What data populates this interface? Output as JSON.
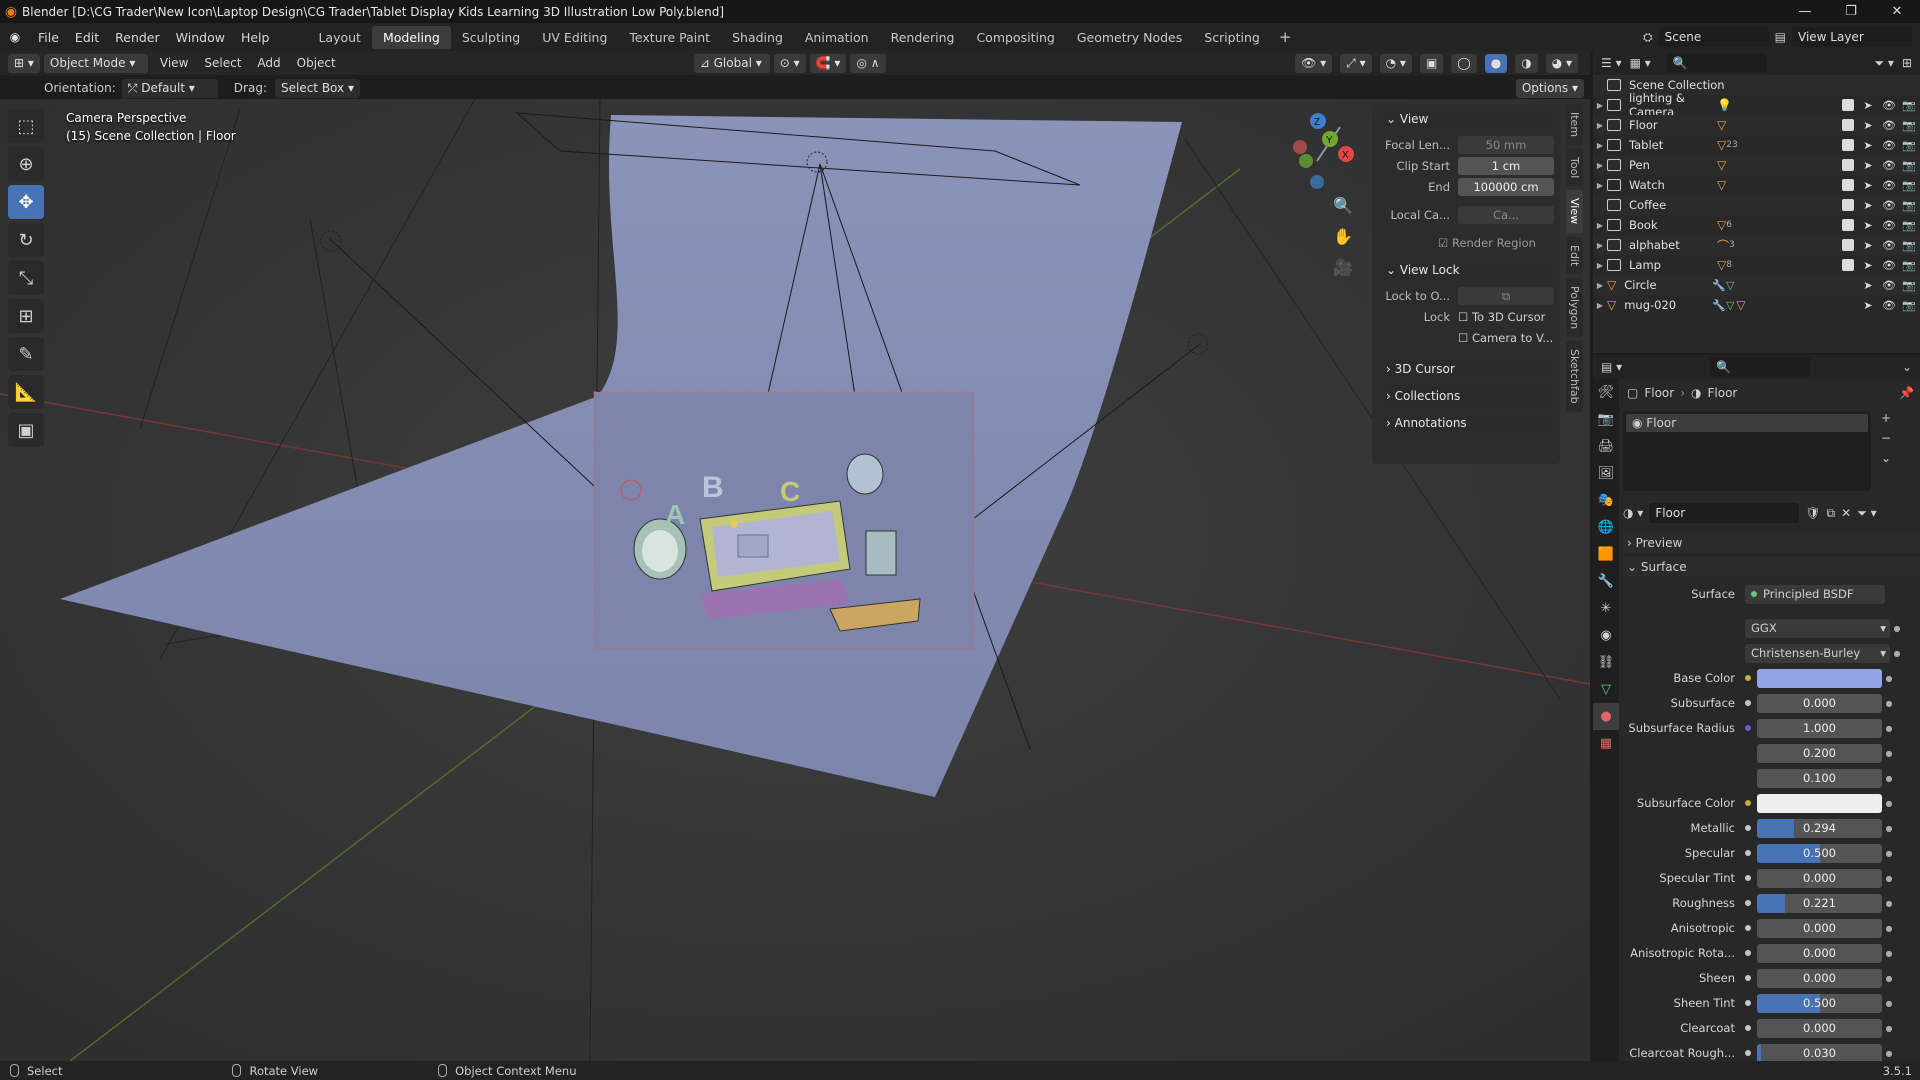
{
  "titlebar": {
    "title": "Blender [D:\\CG Trader\\New Icon\\Laptop Design\\CG Trader\\Tablet Display Kids Learning 3D Illustration Low Poly.blend]",
    "minimize": "—",
    "maximize": "❐",
    "close": "✕"
  },
  "menu": {
    "items": [
      "File",
      "Edit",
      "Render",
      "Window",
      "Help"
    ],
    "workspaces": [
      "Layout",
      "Modeling",
      "Sculpting",
      "UV Editing",
      "Texture Paint",
      "Shading",
      "Animation",
      "Rendering",
      "Compositing",
      "Geometry Nodes",
      "Scripting"
    ],
    "active_workspace": "Modeling",
    "add": "+",
    "scene": "Scene",
    "view_layer": "View Layer"
  },
  "header": {
    "mode": "Object Mode",
    "menus": [
      "View",
      "Select",
      "Add",
      "Object"
    ],
    "transform": "Global",
    "orientation_label": "Orientation:",
    "orientation": "Default",
    "drag_label": "Drag:",
    "drag": "Select Box",
    "options": "Options"
  },
  "viewport": {
    "info_line1": "Camera Perspective",
    "info_line2": "(15) Scene Collection | Floor",
    "gizmo": {
      "x": "X",
      "y": "Y",
      "z": "Z"
    }
  },
  "npanel": {
    "view_header": "View",
    "focal_label": "Focal Len...",
    "focal": "50 mm",
    "clip_start_label": "Clip Start",
    "clip_start": "1 cm",
    "end_label": "End",
    "end": "100000 cm",
    "local_cam_label": "Local Ca...",
    "local_cam": "Ca...",
    "render_region": "Render Region",
    "view_lock": "View Lock",
    "lock_to_label": "Lock to O...",
    "lock_label": "Lock",
    "to_cursor": "To 3D Cursor",
    "cam_to_view": "Camera to V...",
    "cursor3d": "3D Cursor",
    "collections": "Collections",
    "annotations": "Annotations",
    "tabs": [
      "Item",
      "Tool",
      "View",
      "Edit",
      "Polygon",
      "Sketchfab"
    ],
    "active_tab": "View"
  },
  "outliner": {
    "root": "Scene Collection",
    "rows": [
      {
        "name": "lighting & Camera",
        "badge": ""
      },
      {
        "name": "Floor",
        "badge": ""
      },
      {
        "name": "Tablet",
        "badge": "23"
      },
      {
        "name": "Pen",
        "badge": ""
      },
      {
        "name": "Watch",
        "badge": ""
      },
      {
        "name": "Coffee",
        "badge": ""
      },
      {
        "name": "Book",
        "badge": "6"
      },
      {
        "name": "alphabet",
        "badge": "3"
      },
      {
        "name": "Lamp",
        "badge": "8"
      },
      {
        "name": "Circle",
        "badge": ""
      },
      {
        "name": "mug-020",
        "badge": ""
      }
    ]
  },
  "properties": {
    "breadcrumb_obj": "Floor",
    "breadcrumb_mat": "Floor",
    "slot": "Floor",
    "material": "Floor",
    "preview": "Preview",
    "surface_section": "Surface",
    "surface_label": "Surface",
    "surface_value": "Principled BSDF",
    "distribution": "GGX",
    "subsurface_method": "Christensen-Burley",
    "base_color_label": "Base Color",
    "base_color": "#92a3e6",
    "subsurface_color_label": "Subsurface Color",
    "subsurface_color": "#eeeeee",
    "sliders": [
      {
        "label": "Subsurface",
        "value": "0.000",
        "fill": 0
      },
      {
        "label": "Subsurface Radius",
        "value": "1.000",
        "fill": 0
      },
      {
        "label": "",
        "value": "0.200",
        "fill": 0
      },
      {
        "label": "",
        "value": "0.100",
        "fill": 0
      }
    ],
    "sliders2": [
      {
        "label": "Metallic",
        "value": "0.294",
        "fill": 0.294
      },
      {
        "label": "Specular",
        "value": "0.500",
        "fill": 0.5
      },
      {
        "label": "Specular Tint",
        "value": "0.000",
        "fill": 0
      },
      {
        "label": "Roughness",
        "value": "0.221",
        "fill": 0.221
      },
      {
        "label": "Anisotropic",
        "value": "0.000",
        "fill": 0
      },
      {
        "label": "Anisotropic Rota...",
        "value": "0.000",
        "fill": 0
      },
      {
        "label": "Sheen",
        "value": "0.000",
        "fill": 0
      },
      {
        "label": "Sheen Tint",
        "value": "0.500",
        "fill": 0.5
      },
      {
        "label": "Clearcoat",
        "value": "0.000",
        "fill": 0
      },
      {
        "label": "Clearcoat Rough...",
        "value": "0.030",
        "fill": 0.03
      }
    ]
  },
  "status": {
    "select": "Select",
    "rotate": "Rotate View",
    "context": "Object Context Menu",
    "version": "3.5.1"
  }
}
